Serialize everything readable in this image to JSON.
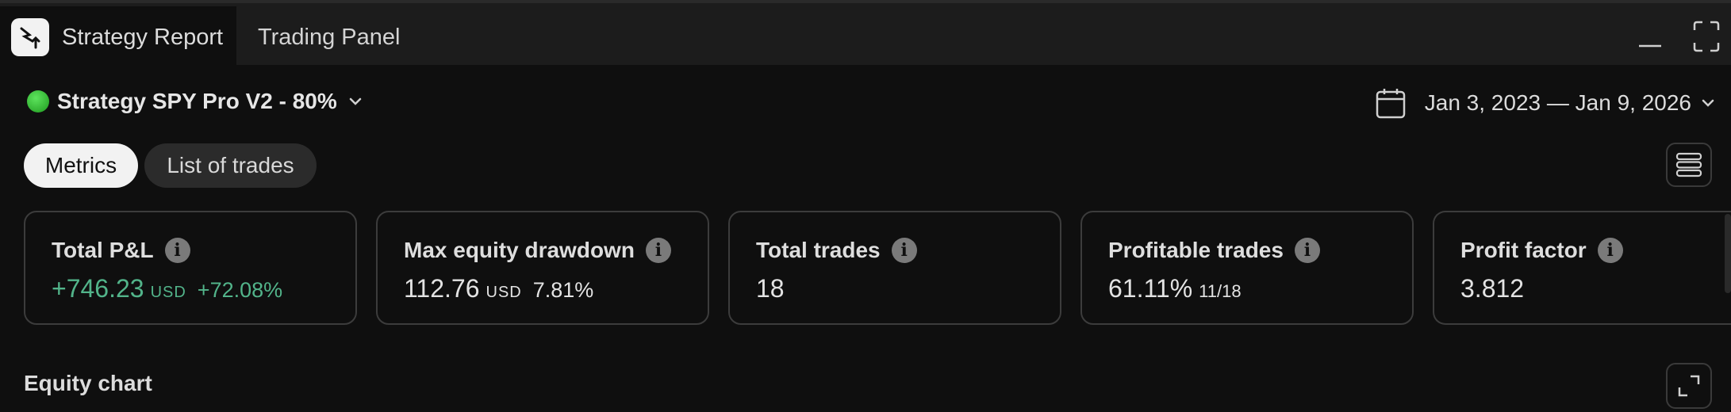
{
  "tabs": {
    "active_label": "Strategy Report",
    "inactive_label": "Trading Panel"
  },
  "strategy": {
    "name": "Strategy SPY Pro V2 - 80%",
    "status_color": "#2ecc40"
  },
  "date_range": {
    "label": "Jan 3, 2023 — Jan 9, 2026"
  },
  "view_toggle": {
    "metrics": "Metrics",
    "list_of_trades": "List of trades"
  },
  "metrics": {
    "total_pnl": {
      "title": "Total P&L",
      "value": "+746.23",
      "unit": "USD",
      "percent": "+72.08%"
    },
    "max_drawdown": {
      "title": "Max equity drawdown",
      "value": "112.76",
      "unit": "USD",
      "percent": "7.81%"
    },
    "total_trades": {
      "title": "Total trades",
      "value": "18"
    },
    "profitable_trades": {
      "title": "Profitable trades",
      "value": "61.11%",
      "ratio": "11/18"
    },
    "profit_factor": {
      "title": "Profit factor",
      "value": "3.812"
    }
  },
  "equity_chart": {
    "title": "Equity chart"
  },
  "colors": {
    "background": "#0f0f0f",
    "positive": "#52b48a",
    "card_border": "#3c3c3c"
  }
}
